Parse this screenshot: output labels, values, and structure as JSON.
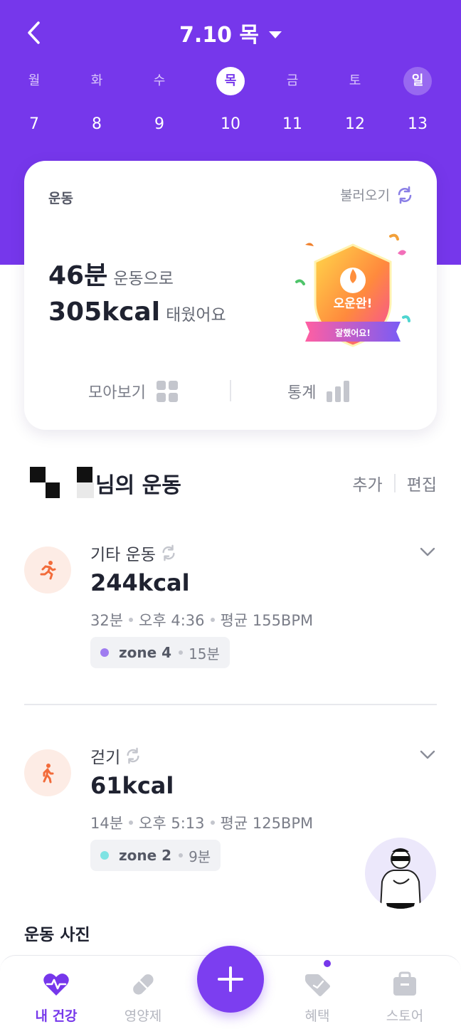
{
  "header": {
    "date_title": "7.10 목",
    "week": [
      {
        "dow": "월",
        "day": "7"
      },
      {
        "dow": "화",
        "day": "8"
      },
      {
        "dow": "수",
        "day": "9"
      },
      {
        "dow": "목",
        "day": "10"
      },
      {
        "dow": "금",
        "day": "11"
      },
      {
        "dow": "토",
        "day": "12"
      },
      {
        "dow": "일",
        "day": "13"
      }
    ],
    "selected_day": "10"
  },
  "summary": {
    "label": "운동",
    "load_label": "불러오기",
    "minutes_value": "46분",
    "minutes_text": "운동으로",
    "kcal_value": "305kcal",
    "kcal_text": "태웠어요",
    "badge_title": "오운완!",
    "badge_ribbon": "잘했어요!",
    "gallery_label": "모아보기",
    "stats_label": "통계"
  },
  "workouts": {
    "title_suffix": "님의 운동",
    "add_label": "추가",
    "edit_label": "편집",
    "items": [
      {
        "name": "기타 운동",
        "kcal": "244kcal",
        "duration": "32분",
        "time": "오후 4:36",
        "avg_bpm": "평균 155BPM",
        "zone": "zone 4",
        "zone_time": "15분",
        "zone_color": "#9f7cf0",
        "icon": "running-icon"
      },
      {
        "name": "걷기",
        "kcal": "61kcal",
        "duration": "14분",
        "time": "오후 5:13",
        "avg_bpm": "평균 125BPM",
        "zone": "zone 2",
        "zone_time": "9분",
        "zone_color": "#7fe3e3",
        "icon": "walking-icon"
      }
    ]
  },
  "photos": {
    "title": "운동 사진"
  },
  "tabbar": {
    "items": [
      {
        "label": "내 건강",
        "icon": "heart-pulse-icon",
        "active": true
      },
      {
        "label": "영양제",
        "icon": "pill-icon",
        "active": false
      },
      {
        "label": "혜택",
        "icon": "tag-icon",
        "active": false
      },
      {
        "label": "스토어",
        "icon": "bag-icon",
        "active": false
      }
    ],
    "fab_icon": "plus-icon"
  },
  "colors": {
    "brand": "#7637eb",
    "exercise_accent": "#f26b3a"
  }
}
